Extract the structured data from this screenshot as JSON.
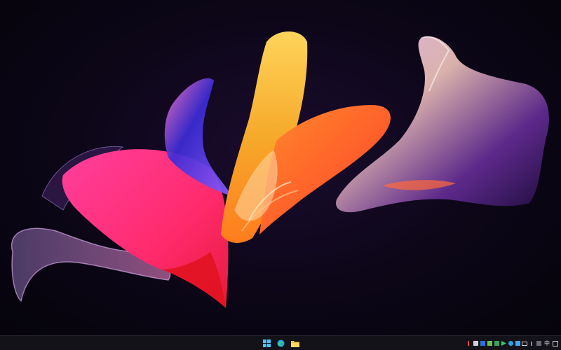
{
  "desktop": {
    "wallpaper_icon": "abstract-bloom-wallpaper",
    "colors": {
      "background": "#0b0613",
      "magenta": "#ff2f8a",
      "orange": "#ff6a1a",
      "yellow": "#f6b52e",
      "violet": "#6a3fc8",
      "taskbar": "#141219"
    }
  },
  "taskbar": {
    "pinned": [
      {
        "name": "start-button",
        "icon": "windows-logo-icon"
      },
      {
        "name": "edge-button",
        "icon": "edge-browser-icon"
      },
      {
        "name": "file-explorer-button",
        "icon": "folder-icon"
      }
    ],
    "tray": {
      "input_indicator": "中",
      "icons": [
        "app-tray-icon",
        "app-tray-icon",
        "app-tray-icon",
        "app-tray-icon",
        "app-tray-icon",
        "app-tray-icon",
        "app-tray-icon",
        "app-tray-icon",
        "keyboard-icon",
        "volume-icon",
        "notification-icon"
      ]
    }
  }
}
